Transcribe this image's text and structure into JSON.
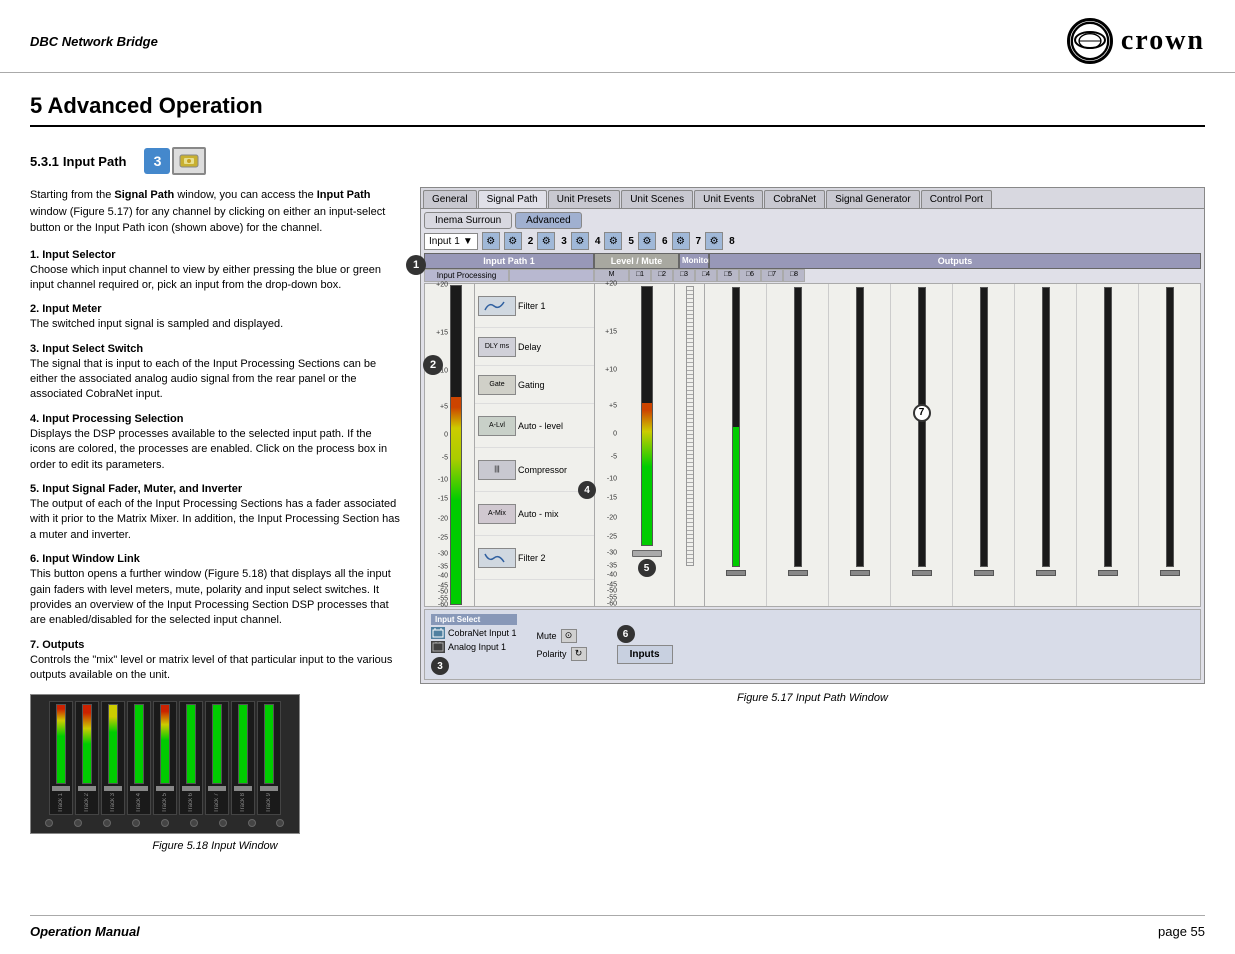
{
  "header": {
    "title": "DBC Network Bridge",
    "logo_text": "crown"
  },
  "chapter": {
    "number": "5",
    "title": "Advanced Operation"
  },
  "section": {
    "number": "5.3.1",
    "name": "Input Path"
  },
  "paragraphs": {
    "intro": "Starting from the Signal Path window, you can access the Input Path window (Figure 5.17) for any channel by clicking on either an input-select button or the Input Path icon (shown above) for the channel.",
    "s1_title": "1. Input Selector",
    "s1_body": "Choose which input channel to view by either pressing the blue or green input channel required or, pick an input from the drop-down box.",
    "s2_title": "2. Input Meter",
    "s2_body": "The switched input signal is sampled and displayed.",
    "s3_title": "3. Input Select Switch",
    "s3_body": "The signal that is input to each of the Input Processing Sections can be either the associated analog audio signal from the rear panel or the associated CobraNet input.",
    "s4_title": "4. Input Processing Selection",
    "s4_body": "Displays the DSP processes available to the selected input path. If the icons are colored, the processes are enabled. Click on the process box in order to edit its parameters.",
    "s5_title": "5. Input Signal Fader, Muter, and Inverter",
    "s5_body": "The output of each of the Input Processing Sections has a fader associated with it prior to the Matrix Mixer. In addition, the Input Processing Section has a muter and inverter.",
    "s6_title": "6. Input Window Link",
    "s6_body": "This button opens a further window (Figure 5.18) that displays all the input gain faders with level meters, mute, polarity and input select switches. It provides an overview of the Input Processing Section DSP processes that are enabled/disabled for the selected input channel.",
    "s7_title": "7. Outputs",
    "s7_body": "Controls the \"mix\" level or matrix level of that particular input to the various outputs available on the unit."
  },
  "ui_tabs": {
    "main": [
      "General",
      "Signal Path",
      "Unit Presets",
      "Unit Scenes",
      "Unit Events",
      "CobraNet",
      "Signal Generator",
      "Control Port"
    ],
    "sub": [
      "Inema Surroun",
      "Advanced"
    ]
  },
  "input_path": {
    "title": "Input Path 1",
    "input_label": "Input",
    "input_value": "1",
    "processing_header": "Input Processing",
    "level_mute_header": "Level / Mute",
    "monitor_header": "Monitor",
    "outputs_header": "Outputs",
    "processes": [
      {
        "name": "Filter 1",
        "icon": "~"
      },
      {
        "name": "Delay",
        "icon": "ms"
      },
      {
        "name": "Gating",
        "icon": "Gate"
      },
      {
        "name": "Auto-level",
        "icon": "AL"
      },
      {
        "name": "Compressor",
        "icon": "|||"
      },
      {
        "name": "Auto-mix",
        "icon": "AM"
      },
      {
        "name": "Filter 2",
        "icon": "~"
      }
    ],
    "scale_labels": [
      "+20",
      "+15",
      "+10",
      "+5",
      "0",
      "-5",
      "-10",
      "-15",
      "-20",
      "-25",
      "-30",
      "-35",
      "-40",
      "-45",
      "-50",
      "-55",
      "-60"
    ],
    "input_sources": [
      "CobraNet Input 1",
      "Analog Input 1"
    ],
    "mute_label": "Mute",
    "polarity_label": "Polarity",
    "inputs_label": "Inputs",
    "output_channels": [
      "1",
      "2",
      "3",
      "4",
      "5",
      "6",
      "7",
      "8"
    ]
  },
  "figures": {
    "fig517": "Figure 5.17  Input Path Window",
    "fig518": "Figure 5.18  Input Window"
  },
  "footer": {
    "left": "Operation Manual",
    "right": "page 55"
  },
  "callouts": [
    "1",
    "2",
    "3",
    "4",
    "5",
    "6",
    "7"
  ]
}
